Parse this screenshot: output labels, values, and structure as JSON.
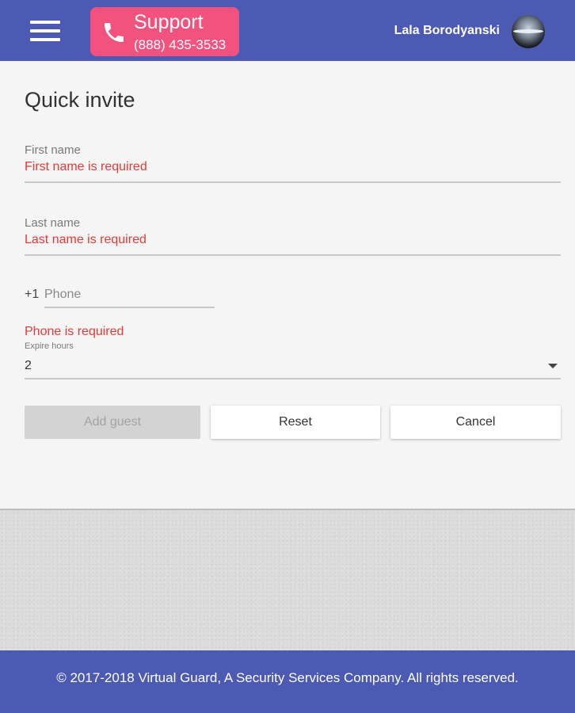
{
  "header": {
    "support_title": "Support",
    "support_number": "(888) 435-3533",
    "user_name": "Lala Borodyanski"
  },
  "form": {
    "title": "Quick invite",
    "first_name": {
      "label": "First name",
      "error": "First name is required"
    },
    "last_name": {
      "label": "Last name",
      "error": "Last name is required"
    },
    "phone": {
      "country_code": "+1",
      "placeholder": "Phone",
      "value": "",
      "error": "Phone is required"
    },
    "expire_hours": {
      "label": "Expire hours",
      "value": "2"
    },
    "buttons": {
      "add_guest": "Add guest",
      "reset": "Reset",
      "cancel": "Cancel"
    }
  },
  "footer": {
    "copyright": "© 2017-2018 Virtual Guard, A Security Services Company. All rights reserved."
  },
  "colors": {
    "header_bg": "#4c5ab4",
    "support_bg": "#f2537e",
    "error": "#e53935"
  },
  "icons": [
    "menu-icon",
    "phone-icon",
    "avatar",
    "dropdown-arrow-icon"
  ]
}
